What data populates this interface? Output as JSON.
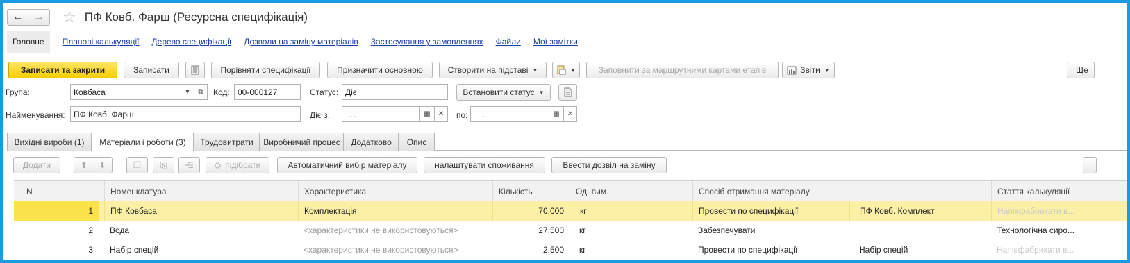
{
  "window": {
    "title": "ПФ Ковб. Фарш (Ресурсна специфікація)"
  },
  "nav": {
    "back": "←",
    "forward": "→",
    "star": "☆"
  },
  "links": {
    "main": "Головне",
    "items": [
      "Планові калькуляції",
      "Дерево специфікації",
      "Дозволи на заміну матеріалів",
      "Застосування у замовленнях",
      "Файли",
      "Мої замітки"
    ]
  },
  "toolbar": {
    "save_close": "Записати та закрити",
    "save": "Записати",
    "compare": "Порівняти специфікації",
    "set_main": "Призначити основною",
    "create_based": "Створити на підставі",
    "fill_routes": "Заповнити за маршрутними картами етапів",
    "reports": "Звіти",
    "more": "Ще"
  },
  "form": {
    "group_label": "Група:",
    "group_value": "Ковбаса",
    "code_label": "Код:",
    "code_value": "00-000127",
    "status_label": "Статус:",
    "status_value": "Діє",
    "set_status": "Встановити статус",
    "name_label": "Найменування:",
    "name_value": "ПФ Ковб. Фарш",
    "valid_from_label": "Діє з:",
    "valid_from_value": " .  .",
    "to_label": "по:",
    "to_value": " .  ."
  },
  "tabs": [
    "Вихідні вироби (1)",
    "Матеріали і роботи (3)",
    "Трудовитрати",
    "Виробничий процес",
    "Додатково",
    "Опис"
  ],
  "table_toolbar": {
    "add": "Додати",
    "pick": "підібрати",
    "auto_select": "Автоматичний вибір матеріалу",
    "consumption": "налаштувати споживання",
    "permit": "Ввести дозвіл на заміну"
  },
  "table": {
    "headers": [
      "N",
      "Номенклатура",
      "Характеристика",
      "Кількість",
      "Од. вим.",
      "Спосіб отримання матеріалу",
      "Стаття калькуляції"
    ],
    "rows": [
      [
        "1",
        "ПФ Ковбаса",
        "Комплектація",
        "70,000",
        "кг",
        "Провести по специфікації",
        "ПФ Ковб. Комплект",
        "Напівфабрикати в..."
      ],
      [
        "2",
        "Вода",
        "<характеристики не використовуються>",
        "27,500",
        "кг",
        "Забезпечувати",
        "",
        "Технологічна сиро..."
      ],
      [
        "3",
        "Набір спецій",
        "<характеристики не використовуються>",
        "2,500",
        "кг",
        "Провести по специфікації",
        "Набір спецій",
        "Напівфабрикати в..."
      ]
    ]
  },
  "colors": {
    "frame": "#1a9be0",
    "primary": "#f7cf00",
    "selected_row": "#fbf0a6",
    "link": "#1a3da8"
  }
}
